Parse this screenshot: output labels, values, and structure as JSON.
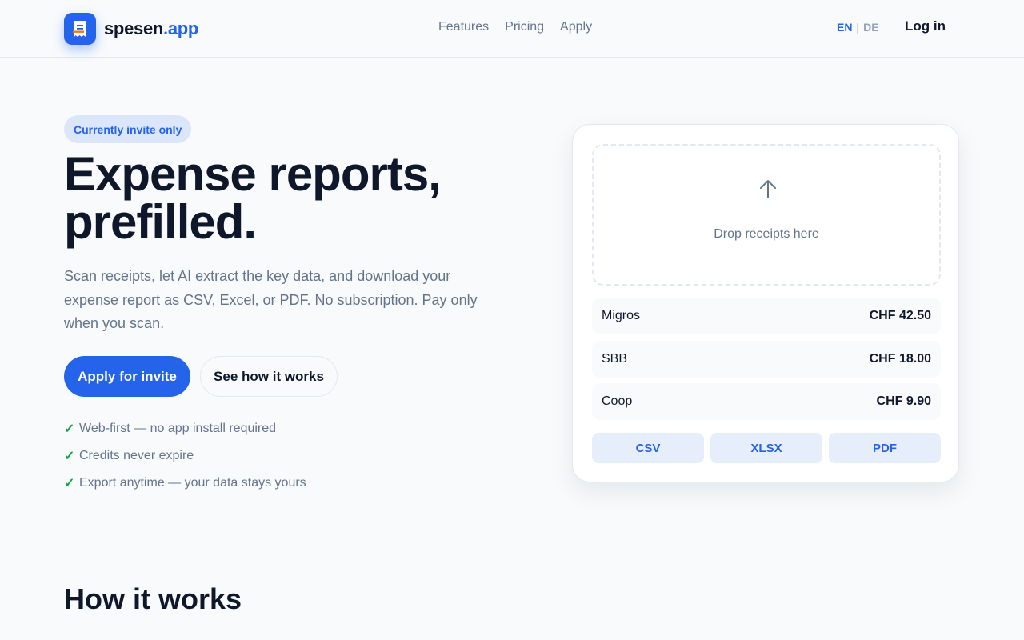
{
  "header": {
    "logo": {
      "name": "spesen",
      "tld": ".app",
      "icon": "receipt-icon"
    },
    "nav": [
      "Features",
      "Pricing",
      "Apply"
    ],
    "lang": {
      "active": "EN",
      "separator": "|",
      "other": "DE"
    },
    "login": "Log in"
  },
  "hero": {
    "badge": "Currently invite only",
    "title_line1": "Expense reports,",
    "title_line2": "prefilled.",
    "subtitle": "Scan receipts, let AI extract the key data, and download your expense report as CSV, Excel, or PDF. No subscription. Pay only when you scan.",
    "primary_cta": "Apply for invite",
    "secondary_cta": "See how it works",
    "features": [
      "Web-first — no app install required",
      "Credits never expire",
      "Export anytime — your data stays yours"
    ],
    "check_icon": "✓"
  },
  "card": {
    "upload_icon": "upload-arrow-icon",
    "drop_label": "Drop receipts here",
    "receipts": [
      {
        "merchant": "Migros",
        "amount": "CHF 42.50"
      },
      {
        "merchant": "SBB",
        "amount": "CHF 18.00"
      },
      {
        "merchant": "Coop",
        "amount": "CHF 9.90"
      }
    ],
    "exports": [
      "CSV",
      "XLSX",
      "PDF"
    ]
  },
  "section": {
    "title": "How it works"
  },
  "colors": {
    "accent": "#2563eb",
    "text": "#0f172a",
    "muted": "#64748b",
    "check": "#16a34a",
    "background": "#f8fafc"
  }
}
